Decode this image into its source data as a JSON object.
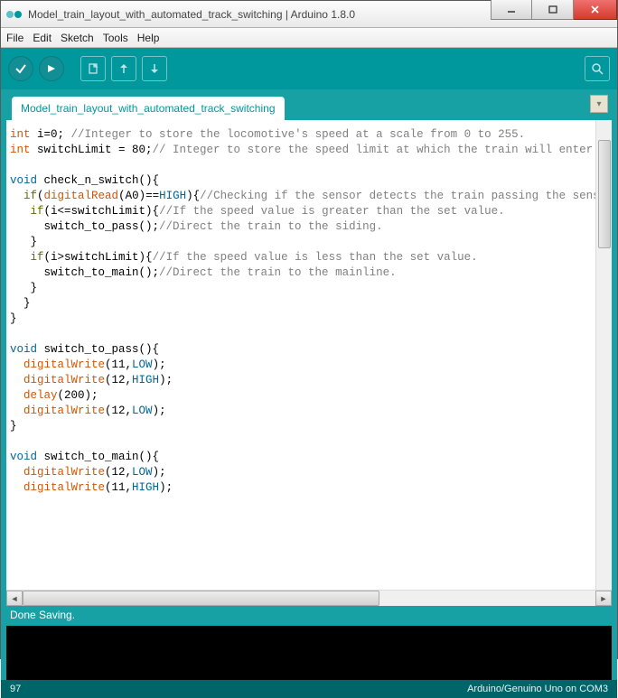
{
  "window": {
    "title": "Model_train_layout_with_automated_track_switching | Arduino 1.8.0"
  },
  "menubar": {
    "items": [
      "File",
      "Edit",
      "Sketch",
      "Tools",
      "Help"
    ]
  },
  "toolbar": {
    "verify": "Verify",
    "upload": "Upload",
    "new": "New",
    "open": "Open",
    "save": "Save",
    "serial": "Serial Monitor"
  },
  "tabs": {
    "active": "Model_train_layout_with_automated_track_switching"
  },
  "code": {
    "lines": [
      {
        "t": "int",
        "c": "type"
      },
      {
        "t": " i=0; "
      },
      {
        "t": "//Integer to store the locomotive's speed at a scale from 0 to 255.",
        "c": "comment"
      },
      {
        "br": 1
      },
      {
        "t": "int",
        "c": "type"
      },
      {
        "t": " switchLimit = 80;"
      },
      {
        "t": "// Integer to store the speed limit at which the train will enter the s",
        "c": "comment"
      },
      {
        "br": 2
      },
      {
        "t": "void",
        "c": "void"
      },
      {
        "t": " check_n_switch(){"
      },
      {
        "br": 1
      },
      {
        "t": "  "
      },
      {
        "t": "if",
        "c": "kw"
      },
      {
        "t": "("
      },
      {
        "t": "digitalRead",
        "c": "func"
      },
      {
        "t": "(A0)=="
      },
      {
        "t": "HIGH",
        "c": "blue"
      },
      {
        "t": "){"
      },
      {
        "t": "//Checking if the sensor detects the train passing the sensored ",
        "c": "comment"
      },
      {
        "br": 1
      },
      {
        "t": "   "
      },
      {
        "t": "if",
        "c": "kw"
      },
      {
        "t": "(i<=switchLimit){"
      },
      {
        "t": "//If the speed value is greater than the set value.",
        "c": "comment"
      },
      {
        "br": 1
      },
      {
        "t": "     switch_to_pass();"
      },
      {
        "t": "//Direct the train to the siding.",
        "c": "comment"
      },
      {
        "br": 1
      },
      {
        "t": "   }"
      },
      {
        "br": 1
      },
      {
        "t": "   "
      },
      {
        "t": "if",
        "c": "kw"
      },
      {
        "t": "(i>switchLimit){"
      },
      {
        "t": "//If the speed value is less than the set value.",
        "c": "comment"
      },
      {
        "br": 1
      },
      {
        "t": "     switch_to_main();"
      },
      {
        "t": "//Direct the train to the mainline.",
        "c": "comment"
      },
      {
        "br": 1
      },
      {
        "t": "   }"
      },
      {
        "br": 1
      },
      {
        "t": "  }"
      },
      {
        "br": 1
      },
      {
        "t": "}"
      },
      {
        "br": 2
      },
      {
        "t": "void",
        "c": "void"
      },
      {
        "t": " switch_to_pass(){"
      },
      {
        "br": 1
      },
      {
        "t": "  "
      },
      {
        "t": "digitalWrite",
        "c": "func"
      },
      {
        "t": "(11,"
      },
      {
        "t": "LOW",
        "c": "blue"
      },
      {
        "t": ");"
      },
      {
        "br": 1
      },
      {
        "t": "  "
      },
      {
        "t": "digitalWrite",
        "c": "func"
      },
      {
        "t": "(12,"
      },
      {
        "t": "HIGH",
        "c": "blue"
      },
      {
        "t": ");"
      },
      {
        "br": 1
      },
      {
        "t": "  "
      },
      {
        "t": "delay",
        "c": "func"
      },
      {
        "t": "(200);"
      },
      {
        "br": 1
      },
      {
        "t": "  "
      },
      {
        "t": "digitalWrite",
        "c": "func"
      },
      {
        "t": "(12,"
      },
      {
        "t": "LOW",
        "c": "blue"
      },
      {
        "t": ");"
      },
      {
        "br": 1
      },
      {
        "t": "}"
      },
      {
        "br": 2
      },
      {
        "t": "void",
        "c": "void"
      },
      {
        "t": " switch_to_main(){"
      },
      {
        "br": 1
      },
      {
        "t": "  "
      },
      {
        "t": "digitalWrite",
        "c": "func"
      },
      {
        "t": "(12,"
      },
      {
        "t": "LOW",
        "c": "blue"
      },
      {
        "t": ");"
      },
      {
        "br": 1
      },
      {
        "t": "  "
      },
      {
        "t": "digitalWrite",
        "c": "func"
      },
      {
        "t": "(11,"
      },
      {
        "t": "HIGH",
        "c": "blue"
      },
      {
        "t": ");"
      }
    ]
  },
  "status": {
    "message": "Done Saving."
  },
  "footer": {
    "line": "97",
    "board": "Arduino/Genuino Uno on COM3"
  }
}
